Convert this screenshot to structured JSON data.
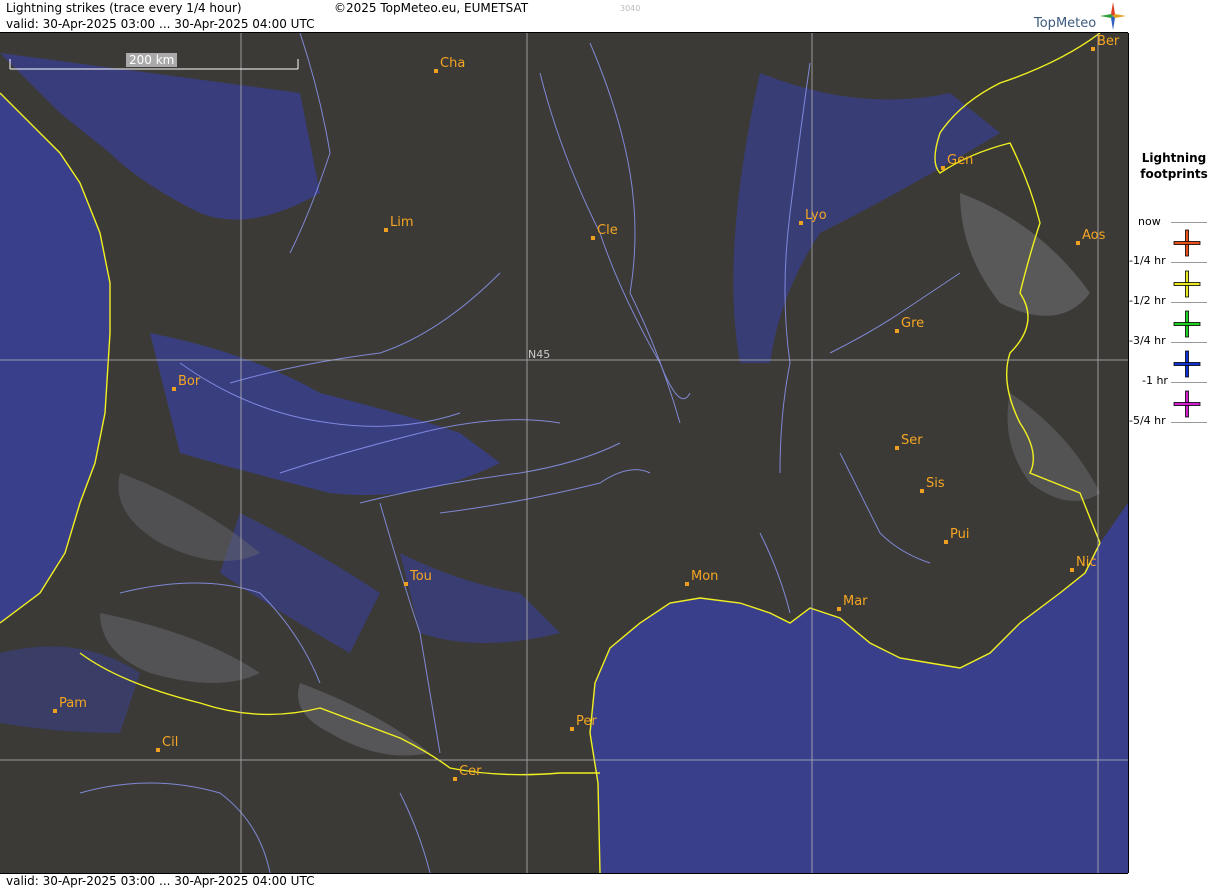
{
  "header": {
    "title": "Lightning strikes (trace every 1/4 hour)",
    "valid": "valid:  30-Apr-2025 03:00 ... 30-Apr-2025 04:00 UTC",
    "copyright": "©2025 TopMeteo.eu, EUMETSAT",
    "code": "3040",
    "logo_text": "TopMeteo"
  },
  "footer": {
    "valid": "valid:  30-Apr-2025 03:00 ... 30-Apr-2025 04:00 UTC"
  },
  "map": {
    "scale_label": "200 km",
    "latitude_label": "N45",
    "cities": [
      {
        "name": "Cha"
      },
      {
        "name": "Lim"
      },
      {
        "name": "Cle"
      },
      {
        "name": "Lyo"
      },
      {
        "name": "Gen"
      },
      {
        "name": "Ber"
      },
      {
        "name": "Aos"
      },
      {
        "name": "Gre"
      },
      {
        "name": "Bor"
      },
      {
        "name": "Ser"
      },
      {
        "name": "Sis"
      },
      {
        "name": "Pui"
      },
      {
        "name": "Tou"
      },
      {
        "name": "Mon"
      },
      {
        "name": "Mar"
      },
      {
        "name": "Nic"
      },
      {
        "name": "Pam"
      },
      {
        "name": "Cil"
      },
      {
        "name": "Per"
      },
      {
        "name": "Cer"
      }
    ]
  },
  "legend": {
    "title_line1": "Lightning",
    "title_line2": "footprints",
    "rows": [
      {
        "label": "now",
        "color": "#e8501a"
      },
      {
        "label": "-1/4 hr",
        "color": "#e8e820"
      },
      {
        "label": "-1/2 hr",
        "color": "#20d020"
      },
      {
        "label": "-3/4 hr",
        "color": "#1030d0"
      },
      {
        "label": "-1 hr",
        "color": "#d020d0"
      },
      {
        "label": "-5/4 hr",
        "color": ""
      }
    ]
  },
  "colors": {
    "sea": "#3a3f8c",
    "land": "#3b3a37",
    "border": "#f0f020",
    "rivers": "#8c96f0",
    "city": "#f5a623"
  }
}
